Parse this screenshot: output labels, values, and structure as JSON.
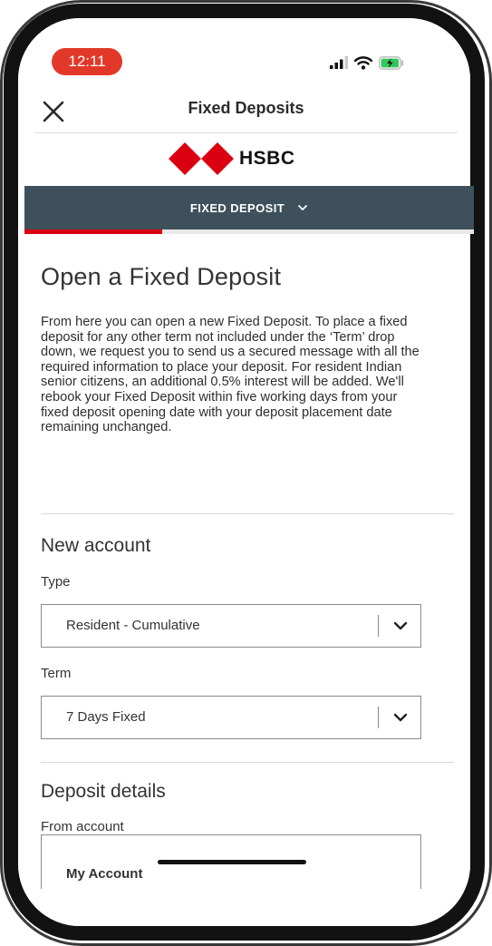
{
  "status_bar": {
    "time": "12:11",
    "icons": [
      "cellular-signal-icon",
      "wifi-icon",
      "battery-charging-icon"
    ],
    "time_pill_color": "#e2382a"
  },
  "header": {
    "title": "Fixed Deposits",
    "close_icon": "close-icon"
  },
  "brand": {
    "name": "HSBC",
    "colors": {
      "red": "#db0011",
      "white": "#ffffff"
    }
  },
  "nav": {
    "label": "FIXED DEPOSIT",
    "dropdown_icon": "chevron-down-icon",
    "background": "#3e505b",
    "active_indicator_color": "#db0011"
  },
  "page": {
    "title": "Open a Fixed Deposit",
    "intro": "From here you can open a new Fixed Deposit. To place a fixed deposit for any other term not included under the ‘Term’ drop down, we request you to send us a secured message with all the required information to place your deposit. For resident Indian senior citizens, an additional 0.5% interest will be added. We'll rebook your Fixed Deposit within five working days from your fixed deposit opening date with your deposit placement date remaining unchanged."
  },
  "new_account": {
    "heading": "New account",
    "type": {
      "label": "Type",
      "value": "Resident - Cumulative"
    },
    "term": {
      "label": "Term",
      "value": "7 Days Fixed"
    }
  },
  "deposit_details": {
    "heading": "Deposit details",
    "from_account": {
      "label": "From account",
      "value": "My Account"
    }
  }
}
